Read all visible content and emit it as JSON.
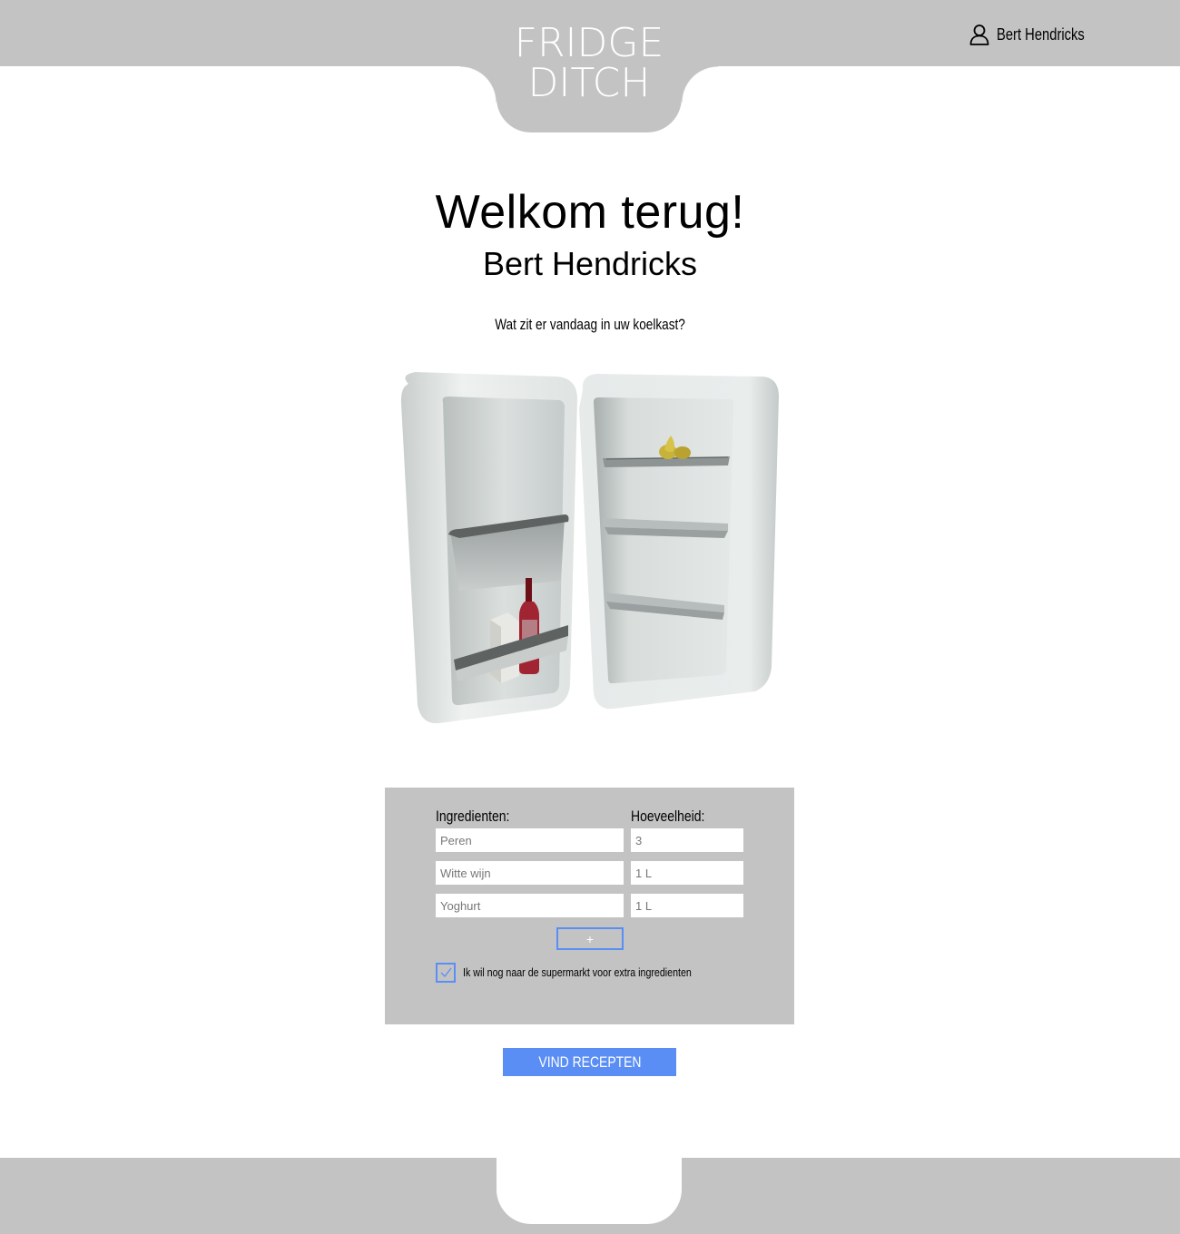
{
  "brand": {
    "line1": "FRIDGE",
    "line2": "DITCH"
  },
  "user": {
    "name": "Bert Hendricks",
    "icon": "user-icon"
  },
  "welcome": {
    "title": "Welkom terug!",
    "name": "Bert Hendricks",
    "question": "Wat zit er vandaag in uw koelkast?"
  },
  "form": {
    "ingredients_label": "Ingredienten:",
    "quantity_label": "Hoeveelheid:",
    "rows": [
      {
        "ingredient_placeholder": "Peren",
        "quantity_placeholder": "3"
      },
      {
        "ingredient_placeholder": "Witte wijn",
        "quantity_placeholder": "1 L"
      },
      {
        "ingredient_placeholder": "Yoghurt",
        "quantity_placeholder": "1 L"
      }
    ],
    "add_label": "+",
    "checkbox_label": "Ik wil nog naar de supermarkt voor extra ingredienten",
    "checkbox_checked": true
  },
  "submit_label": "VIND RECEPTEN",
  "colors": {
    "bar": "#c3c3c3",
    "accent": "#5b8ef5"
  }
}
